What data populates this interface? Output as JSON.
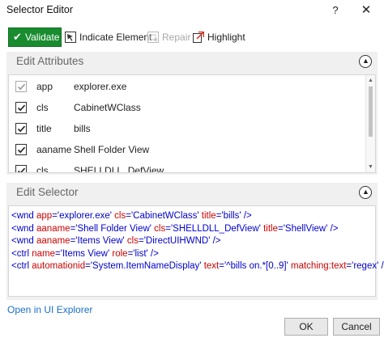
{
  "window": {
    "title": "Selector Editor",
    "help": "?",
    "close": "✕"
  },
  "toolbar": {
    "validate": "Validate",
    "indicate": "Indicate Element",
    "repair": "Repair",
    "highlight": "Highlight"
  },
  "attributes": {
    "title": "Edit Attributes",
    "rows": [
      {
        "name": "app",
        "value": "explorer.exe",
        "checked": true,
        "disabled": true
      },
      {
        "name": "cls",
        "value": "CabinetWClass",
        "checked": true,
        "disabled": false
      },
      {
        "name": "title",
        "value": "bills",
        "checked": true,
        "disabled": false
      },
      {
        "name": "aaname",
        "value": "Shell Folder View",
        "checked": true,
        "disabled": false
      },
      {
        "name": "cls",
        "value": "SHELLDLL_DefView",
        "checked": true,
        "disabled": false
      }
    ]
  },
  "selector": {
    "title": "Edit Selector",
    "lines": [
      [
        [
          "b",
          "<wnd "
        ],
        [
          "a",
          "app"
        ],
        [
          "b",
          "="
        ],
        [
          "v",
          "'explorer.exe'"
        ],
        [
          "b",
          " "
        ],
        [
          "a",
          "cls"
        ],
        [
          "b",
          "="
        ],
        [
          "v",
          "'CabinetWClass'"
        ],
        [
          "b",
          " "
        ],
        [
          "a",
          "title"
        ],
        [
          "b",
          "="
        ],
        [
          "v",
          "'bills'"
        ],
        [
          "b",
          " />"
        ]
      ],
      [
        [
          "b",
          "<wnd "
        ],
        [
          "a",
          "aaname"
        ],
        [
          "b",
          "="
        ],
        [
          "v",
          "'Shell Folder View'"
        ],
        [
          "b",
          " "
        ],
        [
          "a",
          "cls"
        ],
        [
          "b",
          "="
        ],
        [
          "v",
          "'SHELLDLL_DefView'"
        ],
        [
          "b",
          " "
        ],
        [
          "a",
          "title"
        ],
        [
          "b",
          "="
        ],
        [
          "v",
          "'ShellView'"
        ],
        [
          "b",
          " />"
        ]
      ],
      [
        [
          "b",
          "<wnd "
        ],
        [
          "a",
          "aaname"
        ],
        [
          "b",
          "="
        ],
        [
          "v",
          "'Items View'"
        ],
        [
          "b",
          " "
        ],
        [
          "a",
          "cls"
        ],
        [
          "b",
          "="
        ],
        [
          "v",
          "'DirectUIHWND'"
        ],
        [
          "b",
          " />"
        ]
      ],
      [
        [
          "b",
          "<ctrl "
        ],
        [
          "a",
          "name"
        ],
        [
          "b",
          "="
        ],
        [
          "v",
          "'Items View'"
        ],
        [
          "b",
          " "
        ],
        [
          "a",
          "role"
        ],
        [
          "b",
          "="
        ],
        [
          "v",
          "'list'"
        ],
        [
          "b",
          " />"
        ]
      ],
      [
        [
          "b",
          "<ctrl "
        ],
        [
          "a",
          "automationid"
        ],
        [
          "b",
          "="
        ],
        [
          "v",
          "'System.ItemNameDisplay'"
        ],
        [
          "b",
          " "
        ],
        [
          "a",
          "text"
        ],
        [
          "b",
          "="
        ],
        [
          "v",
          "'^bills on.*[0..9]'"
        ],
        [
          "b",
          " "
        ],
        [
          "a",
          "matching:text"
        ],
        [
          "b",
          "="
        ],
        [
          "v",
          "'regex'"
        ],
        [
          "b",
          " />"
        ]
      ]
    ]
  },
  "footer": {
    "link": "Open in UI Explorer",
    "ok": "OK",
    "cancel": "Cancel"
  },
  "colors": {
    "validate_bg": "#198c2f",
    "tag": "#0000cc",
    "attr": "#cc0000",
    "link": "#1a6fc9"
  },
  "icons": {
    "validate": "checkmark-icon",
    "indicate": "cursor-target-icon",
    "repair": "repair-icon",
    "highlight": "highlight-icon",
    "collapse": "chevron-up-icon"
  }
}
